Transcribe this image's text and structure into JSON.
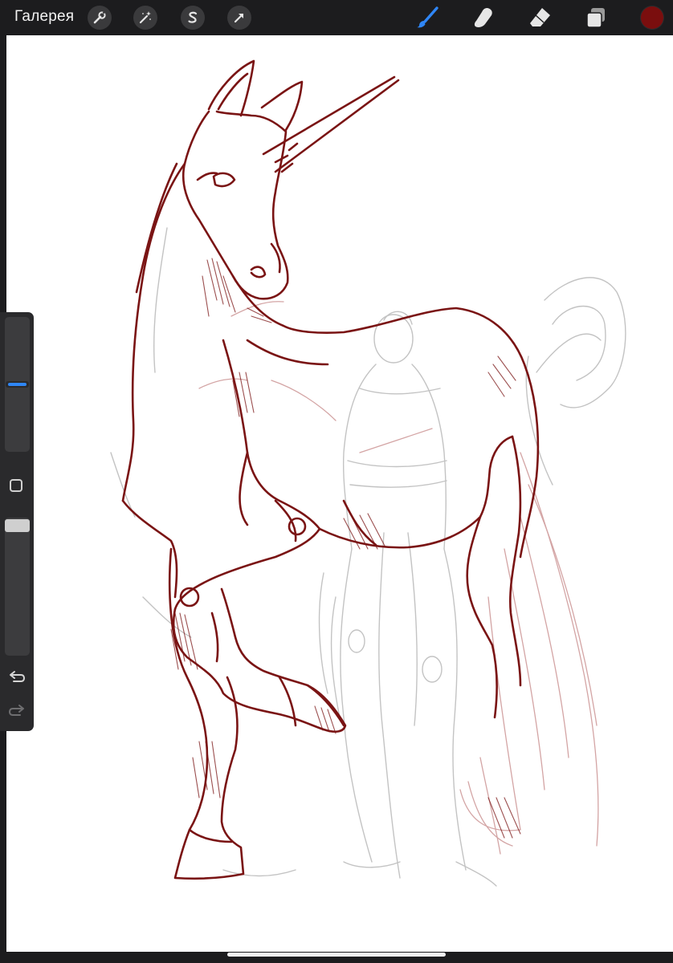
{
  "app": {
    "gallery_label": "Галерея"
  },
  "toolbar": {
    "left_tools": [
      {
        "name": "actions",
        "icon": "wrench-icon"
      },
      {
        "name": "adjustments",
        "icon": "magic-wand-icon"
      },
      {
        "name": "selection",
        "icon": "selection-s-icon"
      },
      {
        "name": "transform",
        "icon": "arrow-cursor-icon"
      }
    ],
    "right_tools": [
      {
        "name": "brush",
        "icon": "brush-icon",
        "active": true
      },
      {
        "name": "smudge",
        "icon": "smudge-finger-icon",
        "active": false
      },
      {
        "name": "eraser",
        "icon": "eraser-icon",
        "active": false
      },
      {
        "name": "layers",
        "icon": "layers-icon",
        "active": false
      }
    ],
    "current_color": "#7a0e0e"
  },
  "colors": {
    "accent": "#2f86f6",
    "sketch_red": "#7a1414",
    "sketch_gray": "#b9b9b9"
  },
  "sidebar": {
    "brush_size": 0.5,
    "brush_opacity": 1.0,
    "undo_icon": "undo-icon",
    "redo_icon": "redo-icon",
    "modify_icon": "square-modify-icon"
  },
  "canvas": {
    "subject": "unicorn-sketch"
  }
}
